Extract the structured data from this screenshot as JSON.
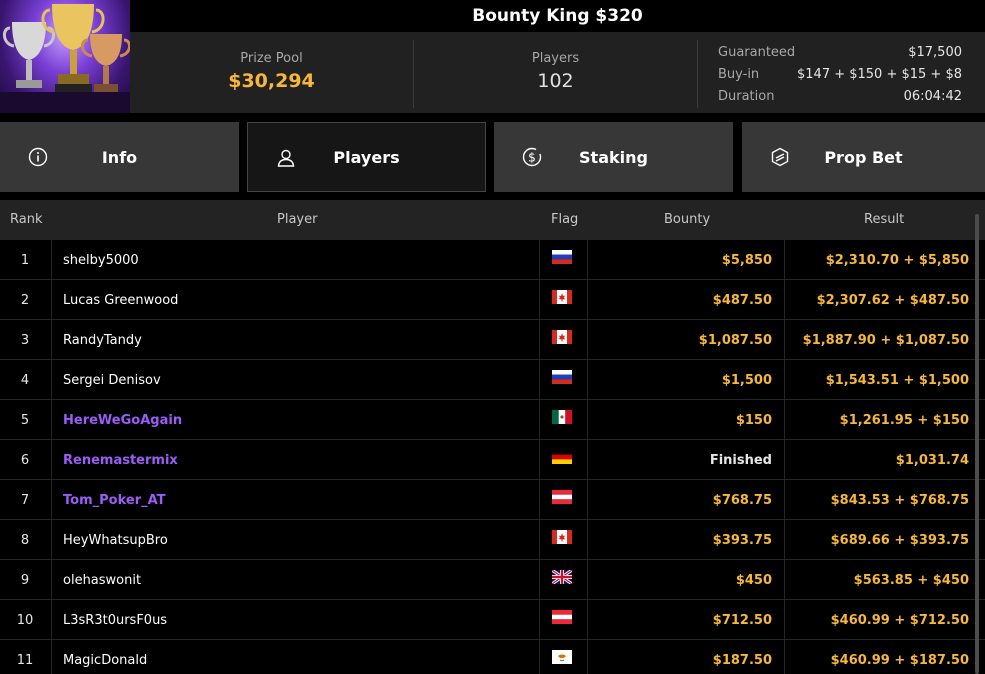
{
  "tournament": {
    "title": "Bounty King $320",
    "prize_pool_label": "Prize Pool",
    "prize_pool": "$30,294",
    "players_label": "Players",
    "players": "102",
    "details": [
      {
        "label": "Guaranteed",
        "value": "$17,500"
      },
      {
        "label": "Buy-in",
        "value": "$147 + $150 + $15 + $8"
      },
      {
        "label": "Duration",
        "value": "06:04:42"
      }
    ]
  },
  "tabs": [
    {
      "label": "Info",
      "icon": "info-icon"
    },
    {
      "label": "Players",
      "icon": "user-icon",
      "active": true
    },
    {
      "label": "Staking",
      "icon": "dollar-coin-icon"
    },
    {
      "label": "Prop Bet",
      "icon": "prop-bet-icon"
    }
  ],
  "table": {
    "headers": {
      "rank": "Rank",
      "player": "Player",
      "flag": "Flag",
      "bounty": "Bounty",
      "result": "Result"
    },
    "rows": [
      {
        "rank": "1",
        "player": "shelby5000",
        "flag": "RU",
        "bounty": "$5,850",
        "result": "$2,310.70 + $5,850"
      },
      {
        "rank": "2",
        "player": "Lucas Greenwood",
        "flag": "CA",
        "bounty": "$487.50",
        "result": "$2,307.62 + $487.50"
      },
      {
        "rank": "3",
        "player": "RandyTandy",
        "flag": "CA",
        "bounty": "$1,087.50",
        "result": "$1,887.90 + $1,087.50"
      },
      {
        "rank": "4",
        "player": "Sergei Denisov",
        "flag": "RU",
        "bounty": "$1,500",
        "result": "$1,543.51 + $1,500"
      },
      {
        "rank": "5",
        "player": "HereWeGoAgain",
        "flag": "MX",
        "bounty": "$150",
        "result": "$1,261.95 + $150",
        "highlight": true
      },
      {
        "rank": "6",
        "player": "Renemastermix",
        "flag": "DE",
        "bounty": "Finished",
        "result": "$1,031.74",
        "highlight": true
      },
      {
        "rank": "7",
        "player": "Tom_Poker_AT",
        "flag": "AT",
        "bounty": "$768.75",
        "result": "$843.53 + $768.75",
        "highlight": true
      },
      {
        "rank": "8",
        "player": "HeyWhatsupBro",
        "flag": "CA",
        "bounty": "$393.75",
        "result": "$689.66 + $393.75"
      },
      {
        "rank": "9",
        "player": "olehaswonit",
        "flag": "GB",
        "bounty": "$450",
        "result": "$563.85 + $450"
      },
      {
        "rank": "10",
        "player": "L3sR3t0ursF0us",
        "flag": "AT",
        "bounty": "$712.50",
        "result": "$460.99 + $712.50"
      },
      {
        "rank": "11",
        "player": "MagicDonald",
        "flag": "CY",
        "bounty": "$187.50",
        "result": "$460.99 + $187.50"
      }
    ]
  },
  "colors": {
    "accent": "#f6b73c",
    "highlight_player": "#9b5cf7"
  }
}
